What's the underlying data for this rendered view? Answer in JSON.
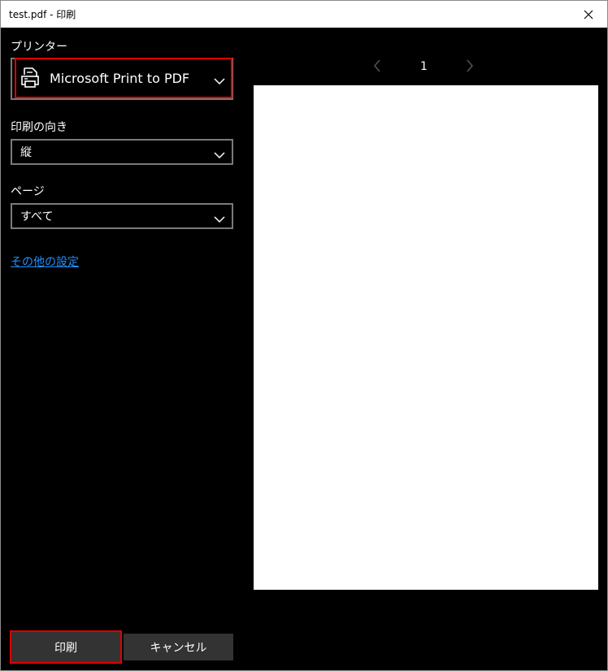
{
  "window": {
    "title": "test.pdf - 印刷"
  },
  "printer": {
    "label": "プリンター",
    "selected": "Microsoft Print to PDF",
    "icon": "printer-icon"
  },
  "orientation": {
    "label": "印刷の向き",
    "selected": "縦"
  },
  "pages": {
    "label": "ページ",
    "selected": "すべて"
  },
  "more_settings_link": "その他の設定",
  "preview": {
    "page_number": "1"
  },
  "buttons": {
    "print_label": "印刷",
    "cancel_label": "キャンセル"
  },
  "colors": {
    "background": "#000000",
    "link": "#1e90ff",
    "highlight": "#e00000",
    "button": "#333333"
  }
}
